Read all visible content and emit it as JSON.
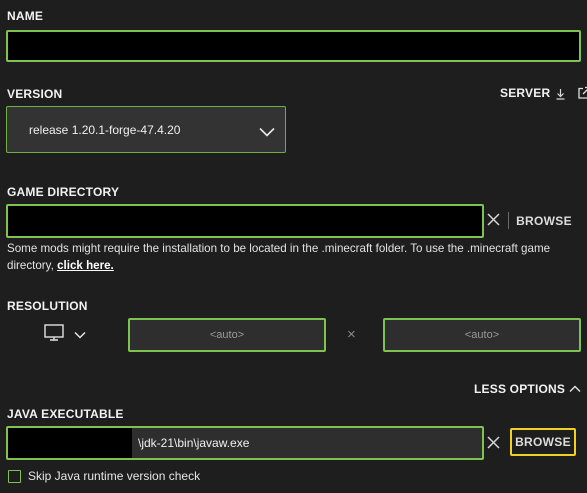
{
  "name": {
    "label": "NAME",
    "value": ""
  },
  "version": {
    "label": "VERSION",
    "selected": "release 1.20.1-forge-47.4.20",
    "server_label": "SERVER"
  },
  "game_directory": {
    "label": "GAME DIRECTORY",
    "value": "",
    "browse_label": "BROWSE",
    "helper_text": "Some mods might require the installation to be located in the .minecraft folder. To use the .minecraft game directory,",
    "helper_link": "click here."
  },
  "resolution": {
    "label": "RESOLUTION",
    "width_value": "<auto>",
    "separator": "×",
    "height_value": "<auto>"
  },
  "options_toggle": {
    "label": "LESS OPTIONS"
  },
  "java_executable": {
    "label": "JAVA EXECUTABLE",
    "value_visible": "\\jdk-21\\bin\\javaw.exe",
    "browse_label": "BROWSE",
    "skip_check_label": "Skip Java runtime version check",
    "skip_check_checked": false
  },
  "colors": {
    "accent_green": "#7ec250",
    "focus_yellow": "#f0d020",
    "background": "#1e1e1e"
  },
  "icons": {
    "download": "download-icon",
    "external_link": "external-link-icon",
    "chevron_down": "chevron-down-icon",
    "chevron_up": "chevron-up-icon",
    "clear": "close-icon",
    "monitor": "monitor-icon"
  }
}
